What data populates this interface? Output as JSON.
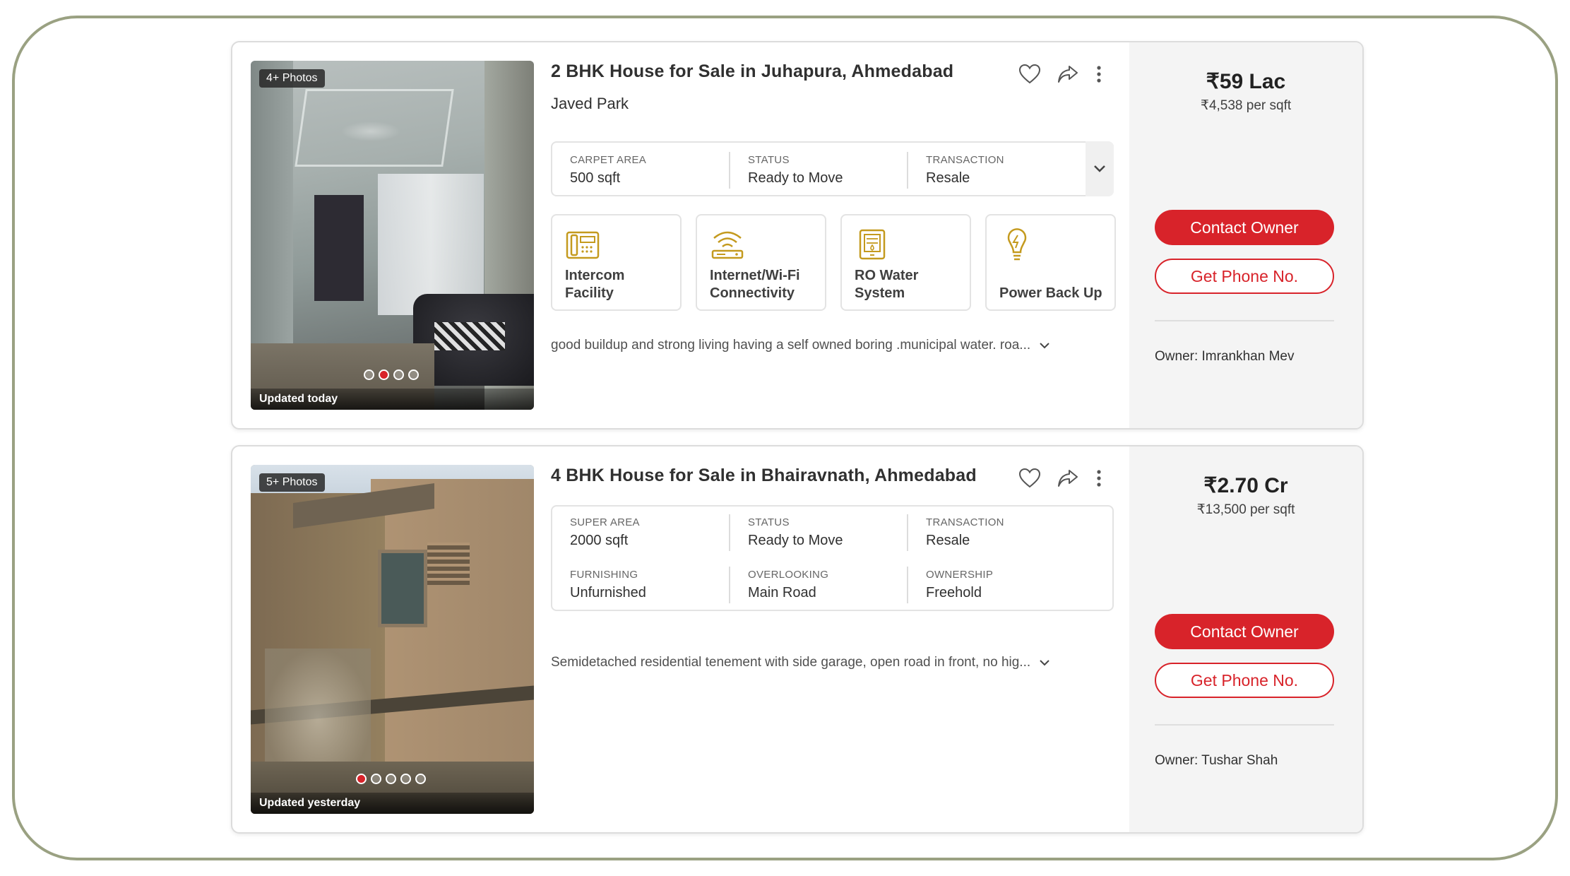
{
  "listings": [
    {
      "photo_badge": "4+ Photos",
      "photo_updated": "Updated today",
      "photo_count_dots": 4,
      "active_dot": 1,
      "title": "2 BHK House for Sale in Juhapura, Ahmedabad",
      "subtitle": "Javed Park",
      "specs": [
        {
          "label": "CARPET AREA",
          "value": "500 sqft"
        },
        {
          "label": "STATUS",
          "value": "Ready to Move"
        },
        {
          "label": "TRANSACTION",
          "value": "Resale"
        }
      ],
      "amenities": [
        {
          "label_line1": "Intercom",
          "label_line2": "Facility",
          "icon": "intercom-icon"
        },
        {
          "label_line1": "Internet/Wi-Fi",
          "label_line2": "Connectivity",
          "icon": "wifi-icon"
        },
        {
          "label_line1": "RO Water",
          "label_line2": "System",
          "icon": "water-filter-icon"
        },
        {
          "label_line1": "Power Back Up",
          "label_line2": "",
          "icon": "bulb-icon"
        }
      ],
      "description": "good buildup and strong living having a self owned boring .municipal water. roa...",
      "price": "₹59 Lac",
      "price_per_sqft": "₹4,538 per sqft",
      "contact_label": "Contact Owner",
      "phone_label": "Get Phone No.",
      "owner": "Owner: Imrankhan Mev"
    },
    {
      "photo_badge": "5+ Photos",
      "photo_updated": "Updated yesterday",
      "photo_count_dots": 5,
      "active_dot": 0,
      "title": "4 BHK House for Sale in Bhairavnath, Ahmedabad",
      "specs": [
        {
          "label": "SUPER AREA",
          "value": "2000 sqft"
        },
        {
          "label": "STATUS",
          "value": "Ready to Move"
        },
        {
          "label": "TRANSACTION",
          "value": "Resale"
        },
        {
          "label": "FURNISHING",
          "value": "Unfurnished"
        },
        {
          "label": "OVERLOOKING",
          "value": "Main Road"
        },
        {
          "label": "OWNERSHIP",
          "value": "Freehold"
        }
      ],
      "description": "Semidetached residential tenement with side garage, open road in front, no hig...",
      "price": "₹2.70 Cr",
      "price_per_sqft": "₹13,500 per sqft",
      "contact_label": "Contact Owner",
      "phone_label": "Get Phone No.",
      "owner": "Owner: Tushar Shah"
    }
  ],
  "colors": {
    "brand_red": "#d8232a",
    "amenity_icon": "#c49a1e",
    "frame_border": "#9aa182"
  }
}
